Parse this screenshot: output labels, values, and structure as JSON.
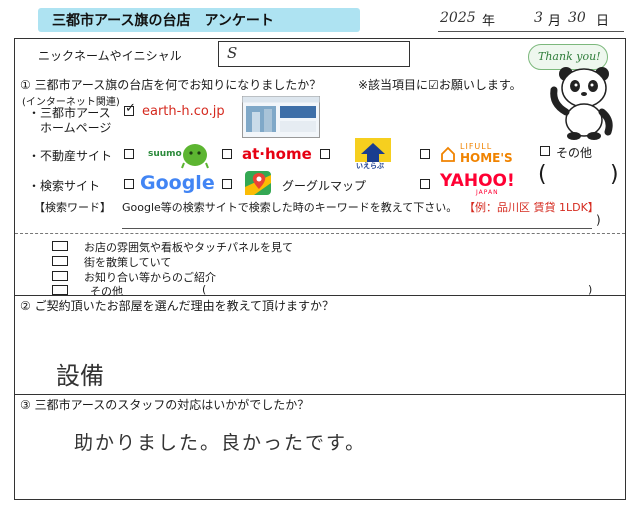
{
  "header": {
    "title": "三都市アース旗の台店　アンケート",
    "date": {
      "year": "2025",
      "year_unit": "年",
      "month": "3",
      "month_unit": "月",
      "day": "30",
      "day_unit": "日"
    }
  },
  "nickname": {
    "label": "ニックネームやイニシャル",
    "value": "S"
  },
  "mascot": {
    "speech": "Thank you!"
  },
  "q1": {
    "title": "① 三都市アース旗の台店を何でお知りになりましたか？",
    "note": "※該当項目に☑お願いします。",
    "internet_label": "(インターネット関連)",
    "homepage": {
      "label_line1": "三都市アース",
      "label_line2": "ホームページ",
      "url": "earth-h.co.jp",
      "check": "✓"
    },
    "realestate": {
      "label": "不動産サイト",
      "suumo": "suumo",
      "athome": "at·home",
      "ieshil": "いえらぶ",
      "homes_top": "LIFULL",
      "homes": "HOME'S",
      "other": "その他"
    },
    "search": {
      "label": "検索サイト",
      "google": "Google",
      "maps": "グーグルマップ",
      "yahoo": "YAHOO!",
      "yahoo_sub": "JAPAN",
      "paren_open": "(",
      "paren_close": ")"
    },
    "keyword": {
      "label": "【検索ワード】",
      "text": "Google等の検索サイトで検索した時のキーワードを教えて下さい。",
      "example": "【例：品川区 賃貸 1LDK】",
      "paren": ")"
    },
    "offline": [
      {
        "text": "お店の雰囲気や看板やタッチパネルを見て"
      },
      {
        "text": "街を散策していて"
      },
      {
        "text": "お知り合い等からのご紹介"
      },
      {
        "text": "その他",
        "open": "(",
        "close": ")"
      }
    ]
  },
  "q2": {
    "title": "② ご契約頂いたお部屋を選んだ理由を教えて頂けますか？",
    "answer": "設備"
  },
  "q3": {
    "title": "③ 三都市アースのスタッフの対応はいかがでしたか？",
    "answer": "助かりました。良かったです。"
  },
  "colors": {
    "title_bar": "#aee3f2",
    "red": "#d52a1f",
    "google_blue": "#4285f4",
    "yahoo_red": "#ff0033",
    "homes_orange": "#f08300",
    "athome_red": "#e60012"
  }
}
